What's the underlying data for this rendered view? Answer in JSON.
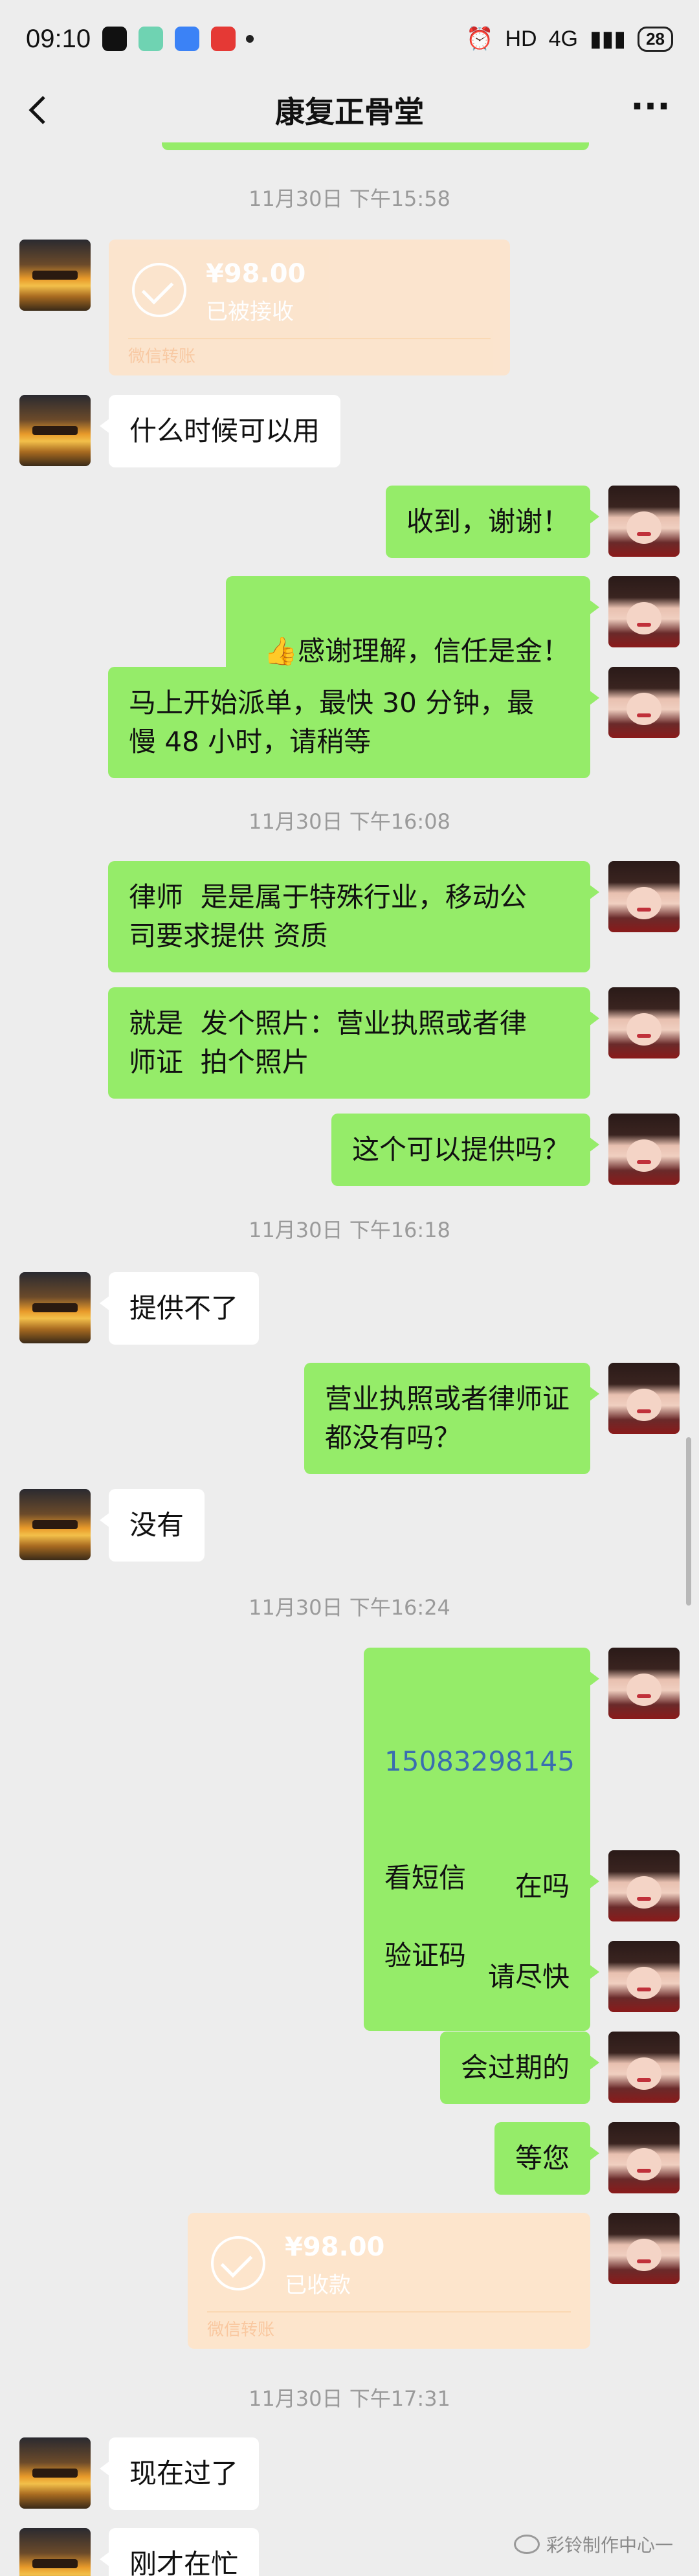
{
  "status_bar": {
    "time": "09:10",
    "network": "HD",
    "signal": "4G",
    "battery": "28"
  },
  "nav": {
    "title": "康复正骨堂",
    "more_label": "···"
  },
  "timestamps": [
    "11月30日 下午15:58",
    "11月30日 下午16:08",
    "11月30日 下午16:18",
    "11月30日 下午16:24",
    "11月30日 下午17:31"
  ],
  "messages": {
    "t1_amount": "¥98.00",
    "t1_status": "已被接收",
    "t1_label": "微信转账",
    "m1": "什么时候可以用",
    "m2": "收到，谢谢！",
    "m3_emoji": "👍",
    "m3": "感谢理解，信任是金！",
    "m4": "马上开始派单，最快 30 分钟，最\n慢 48 小时，请稍等",
    "m5": "律师  是是属于特殊行业，移动公\n司要求提供 资质",
    "m6": "就是  发个照片：营业执照或者律\n师证  拍个照片",
    "m7": "这个可以提供吗？",
    "m8": "提供不了",
    "m9": "营业执照或者律师证\n都没有吗？",
    "m10": "没有",
    "m11_phone": "15083298145",
    "m11": "看短信\n\n验证码发给我",
    "m12": "在吗",
    "m13": "请尽快",
    "m14": "会过期的",
    "m15": "等您",
    "t2_amount": "¥98.00",
    "t2_status": "已收款",
    "t2_label": "微信转账",
    "m16": "现在过了",
    "m17": "刚才在忙"
  },
  "watermark": "彩铃制作中心一"
}
